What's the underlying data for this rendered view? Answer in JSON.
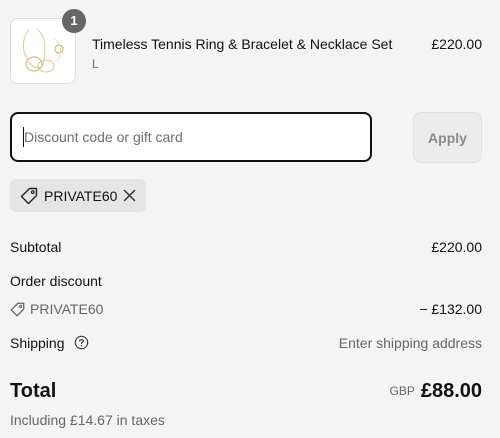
{
  "product": {
    "quantity_badge": "1",
    "name": "Timeless Tennis Ring & Bracelet & Necklace Set",
    "variant": "L",
    "price": "£220.00",
    "thumbnail_icon": "jewelry-image"
  },
  "discount_form": {
    "placeholder": "Discount code or gift card",
    "value": "",
    "apply_label": "Apply"
  },
  "applied_code": {
    "label": "PRIVATE60",
    "tag_icon": "tag-icon",
    "remove_icon": "close-icon"
  },
  "summary": {
    "subtotal_label": "Subtotal",
    "subtotal_value": "£220.00",
    "order_discount_label": "Order discount",
    "discount_code": "PRIVATE60",
    "discount_amount": "− £132.00",
    "shipping_label": "Shipping",
    "shipping_help_icon": "help-circle-icon",
    "shipping_value": "Enter shipping address",
    "total_label": "Total",
    "total_currency": "GBP",
    "total_value": "£88.00",
    "taxes_note": "Including £14.67 in taxes"
  },
  "colors": {
    "background": "#f4f4f4",
    "text": "#111111",
    "muted_text": "#666666",
    "badge": "#666666",
    "chip": "#e5e5e5",
    "apply_button": "#ececec"
  }
}
